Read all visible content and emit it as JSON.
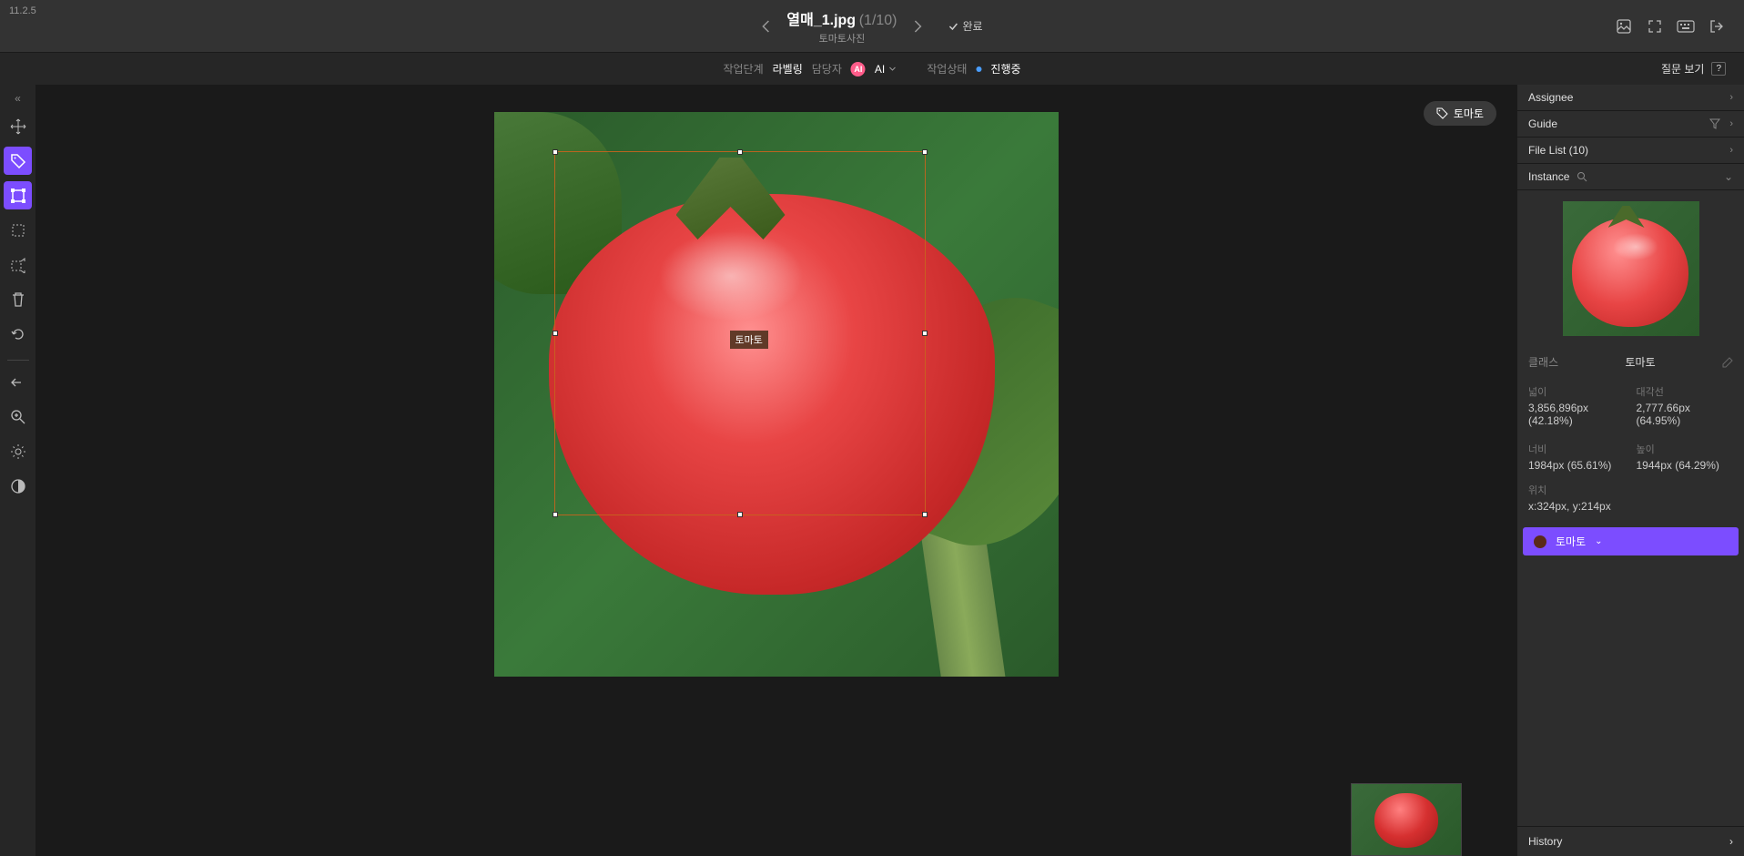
{
  "version": "11.2.5",
  "header": {
    "filename": "열매_1.jpg",
    "counter": "(1/10)",
    "subtitle": "토마토사진",
    "complete": "완료"
  },
  "subheader": {
    "stage_label": "작업단계",
    "stage_value": "라벨링",
    "assignee_label": "담당자",
    "ai_label": "AI",
    "status_label": "작업상태",
    "status_value": "진행중",
    "question": "질문 보기"
  },
  "canvas": {
    "tag": "토마토",
    "bbox_label": "토마토"
  },
  "panel": {
    "assignee": "Assignee",
    "guide": "Guide",
    "filelist": "File List (10)",
    "instance": "Instance",
    "class_label": "클래스",
    "class_value": "토마토",
    "dims": {
      "area_label": "넓이",
      "area_value": "3,856,896px (42.18%)",
      "diag_label": "대각선",
      "diag_value": "2,777.66px (64.95%)",
      "width_label": "너비",
      "width_value": "1984px (65.61%)",
      "height_label": "높이",
      "height_value": "1944px (64.29%)",
      "pos_label": "위치",
      "pos_value": "x:324px, y:214px"
    },
    "instance_name": "토마토",
    "history": "History"
  }
}
